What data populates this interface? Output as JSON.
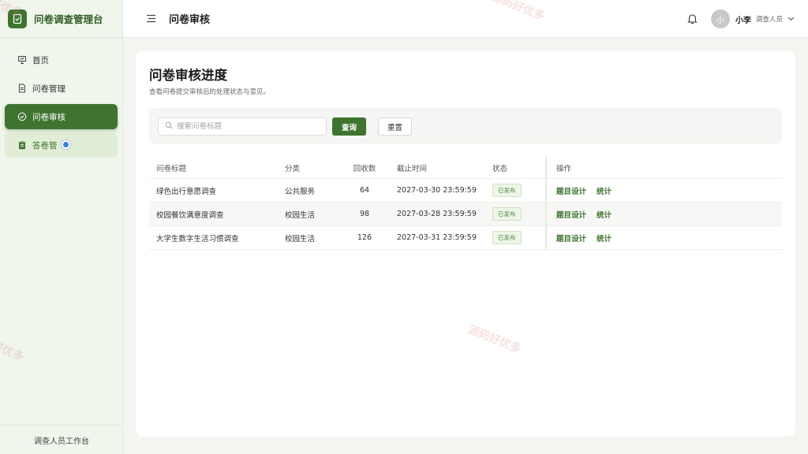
{
  "brand": {
    "title": "问卷调查管理台"
  },
  "sidebar": {
    "items": [
      {
        "label": "首页",
        "icon": "presentation-icon"
      },
      {
        "label": "问卷管理",
        "icon": "document-icon"
      },
      {
        "label": "问卷审核",
        "icon": "check-circle-icon",
        "active": true
      },
      {
        "label": "答卷管",
        "icon": "clipboard-icon",
        "hover": true
      }
    ],
    "footer": "调查人员工作台"
  },
  "header": {
    "title": "问卷审核",
    "user": {
      "avatar_text": "小",
      "name": "小李",
      "role": "调查人员"
    }
  },
  "main": {
    "title": "问卷审核进度",
    "subtitle": "查看问卷提交审核后的处理状态与意见。",
    "search": {
      "placeholder": "搜索问卷标题",
      "value": ""
    },
    "query_label": "查询",
    "reset_label": "重置",
    "table": {
      "headers": [
        "问卷标题",
        "分类",
        "回收数",
        "截止时间",
        "状态",
        "操作"
      ],
      "rows": [
        {
          "title": "绿色出行意愿调查",
          "category": "公共服务",
          "count": "64",
          "deadline": "2027-03-30 23:59:59",
          "status": "已发布",
          "op1": "题目设计",
          "op2": "统计"
        },
        {
          "title": "校园餐饮满意度调查",
          "category": "校园生活",
          "count": "98",
          "deadline": "2027-03-28 23:59:59",
          "status": "已发布",
          "op1": "题目设计",
          "op2": "统计"
        },
        {
          "title": "大学生数字生活习惯调查",
          "category": "校园生活",
          "count": "126",
          "deadline": "2027-03-31 23:59:59",
          "status": "已发布",
          "op1": "题目设计",
          "op2": "统计"
        }
      ]
    }
  },
  "watermark": "源码好优多",
  "colors": {
    "accent": "#3e7430",
    "sidebar_bg": "#f1f6ec",
    "badge_text": "#4f8a3d"
  }
}
